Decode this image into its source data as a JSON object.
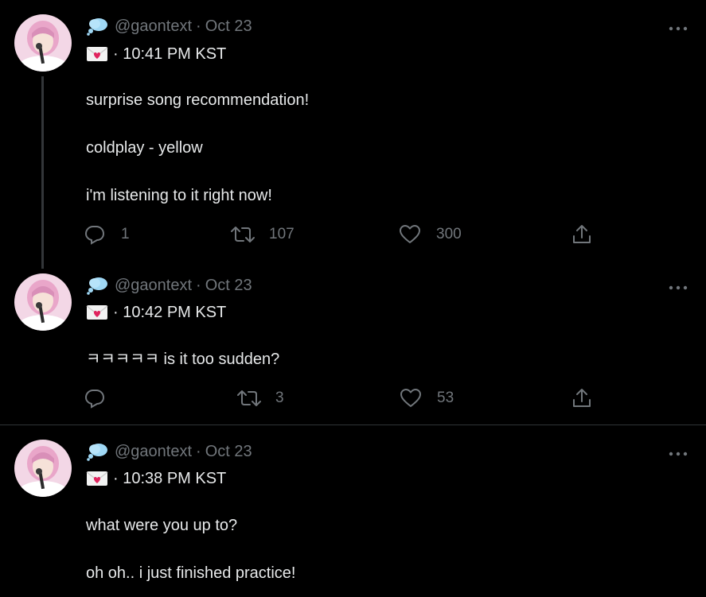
{
  "tweets": [
    {
      "handle": "@gaontext",
      "dot": "·",
      "date": "Oct 23",
      "time_line": "· 10:41 PM KST",
      "lines": [
        "surprise song recommendation!",
        "coldplay - yellow",
        "i'm listening to it right now!"
      ],
      "replies": "1",
      "retweets": "107",
      "likes": "300"
    },
    {
      "handle": "@gaontext",
      "dot": "·",
      "date": "Oct 23",
      "time_line": "· 10:42 PM KST",
      "lines": [
        "ㅋㅋㅋㅋㅋ is it too sudden?"
      ],
      "replies": "",
      "retweets": "3",
      "likes": "53"
    },
    {
      "handle": "@gaontext",
      "dot": "·",
      "date": "Oct 23",
      "time_line": "· 10:38 PM KST",
      "lines": [
        "what were you up to?",
        "oh oh.. i just finished practice!"
      ],
      "replies": "",
      "retweets": "",
      "likes": ""
    }
  ],
  "icons": {
    "header_1": "thought-balloon-emoji",
    "header_2": "love-letter-emoji",
    "reply": "reply-icon",
    "retweet": "retweet-icon",
    "like": "heart-icon",
    "share": "share-icon",
    "more": "more-icon"
  },
  "colors": {
    "background": "#000000",
    "text": "#e7e9ea",
    "muted": "#71767b",
    "divider": "#2f3336",
    "thread_line": "#333639",
    "avatar_hair": "#e9a6c9",
    "balloon": "#9fd8f5",
    "heart": "#e0245e"
  }
}
